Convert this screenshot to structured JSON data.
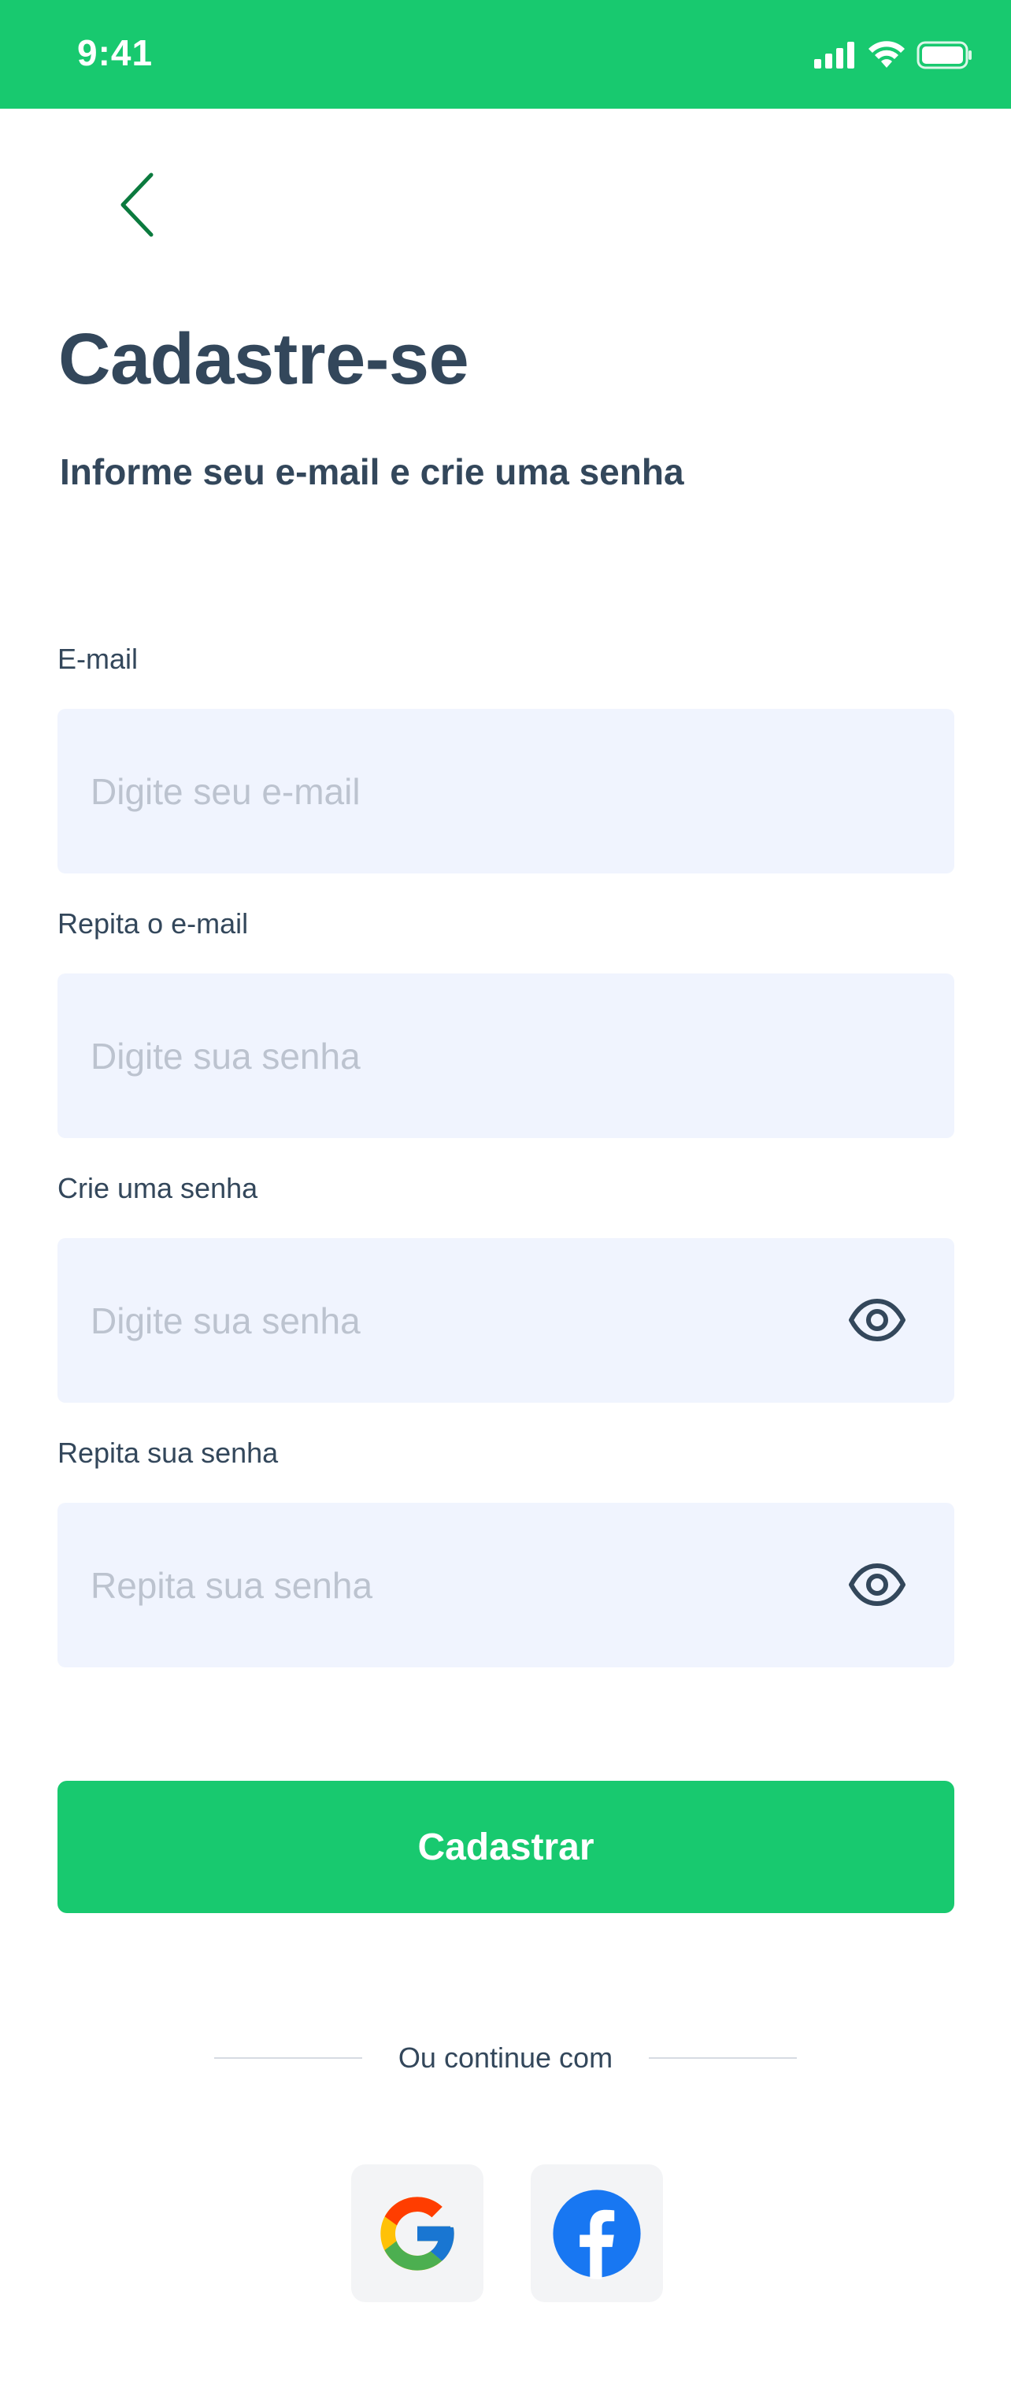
{
  "status_bar": {
    "time": "9:41",
    "icons": [
      "signal-icon",
      "wifi-icon",
      "battery-icon"
    ],
    "color": "#18c96f"
  },
  "header": {
    "back_icon": "chevron-left-icon",
    "title": "Cadastre-se",
    "subtitle": "Informe seu e-mail e crie uma senha"
  },
  "form": {
    "email": {
      "label": "E-mail",
      "placeholder": "Digite seu e-mail",
      "value": ""
    },
    "email_confirm": {
      "label": "Repita o e-mail",
      "placeholder": "Digite sua senha",
      "value": ""
    },
    "password": {
      "label": "Crie uma senha",
      "placeholder": "Digite sua senha",
      "value": "",
      "toggle_icon": "eye-icon"
    },
    "password_confirm": {
      "label": "Repita sua senha",
      "placeholder": "Repita sua senha",
      "value": "",
      "toggle_icon": "eye-icon"
    },
    "submit_label": "Cadastrar"
  },
  "social": {
    "divider_text": "Ou continue com",
    "providers": [
      {
        "name": "Google",
        "icon": "google-icon"
      },
      {
        "name": "Facebook",
        "icon": "facebook-icon"
      }
    ]
  },
  "colors": {
    "accent": "#18c96f",
    "text": "#33475b",
    "field_bg": "#f0f4fe",
    "placeholder": "#bcc3cf",
    "back_chevron": "#0b7a3e",
    "facebook": "#1877f2"
  }
}
